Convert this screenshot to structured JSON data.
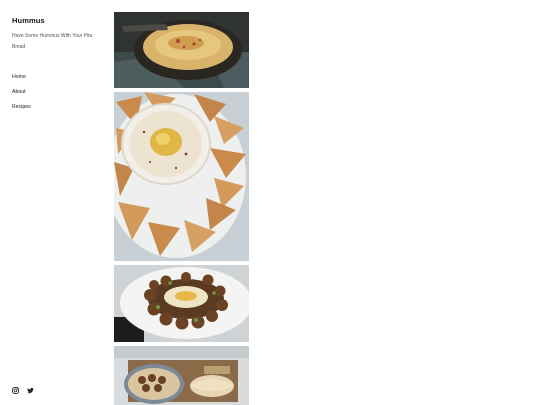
{
  "site": {
    "title": "Hummus",
    "tagline": "Have Some Hummus With Your Pita Bread"
  },
  "nav": {
    "items": [
      "Home",
      "About",
      "Recipes"
    ]
  },
  "social": {
    "icons": [
      "instagram-icon",
      "twitter-icon"
    ]
  },
  "gallery": {
    "images": [
      "hummus-bowl-photo",
      "hummus-with-pita-chips-photo",
      "falafel-around-hummus-photo",
      "hummus-platter-with-pita-photo"
    ]
  },
  "colors": {
    "background": "#ffffff",
    "text": "#1b1b1b",
    "muted_text": "#555555"
  }
}
